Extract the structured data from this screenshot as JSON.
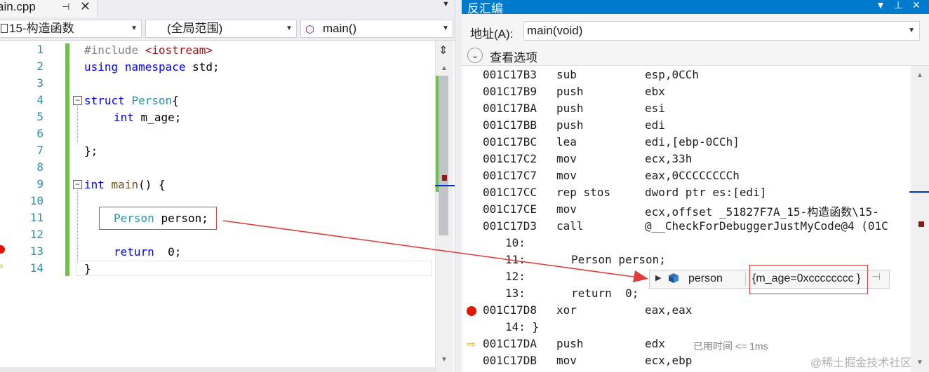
{
  "editor": {
    "tab": {
      "filename": "ain.cpp",
      "pin_icon": "pin-icon",
      "close_icon": "close-icon"
    },
    "nav": {
      "project": "15-构造函数",
      "scope": "(全局范围)",
      "function": "main()"
    },
    "line_numbers": [
      "1",
      "2",
      "3",
      "4",
      "5",
      "6",
      "7",
      "8",
      "9",
      "10",
      "11",
      "12",
      "13",
      "14"
    ],
    "code": {
      "l1_directive": "#include",
      "l1_header": "<iostream>",
      "l2_using": "using",
      "l2_namespace": "namespace",
      "l2_std": "std;",
      "l4_struct": "struct",
      "l4_name": "Person",
      "l4_brace": "{",
      "l5_int": "int",
      "l5_member": "m_age;",
      "l7_close": "};",
      "l9_int": "int",
      "l9_main": "main",
      "l9_rest": "() {",
      "l11_type": "Person",
      "l11_var": "person;",
      "l13_return": "return",
      "l13_val": "0;",
      "l14_close": "}"
    }
  },
  "disassembly": {
    "title": "反汇编",
    "address_label": "地址(A):",
    "address_value": "main(void)",
    "options_label": "查看选项",
    "rows": [
      {
        "addr": "001C17B3",
        "mn": "sub",
        "op": "esp,0CCh"
      },
      {
        "addr": "001C17B9",
        "mn": "push",
        "op": "ebx"
      },
      {
        "addr": "001C17BA",
        "mn": "push",
        "op": "esi"
      },
      {
        "addr": "001C17BB",
        "mn": "push",
        "op": "edi"
      },
      {
        "addr": "001C17BC",
        "mn": "lea",
        "op": "edi,[ebp-0CCh]"
      },
      {
        "addr": "001C17C2",
        "mn": "mov",
        "op": "ecx,33h"
      },
      {
        "addr": "001C17C7",
        "mn": "mov",
        "op": "eax,0CCCCCCCCh"
      },
      {
        "addr": "001C17CC",
        "mn": "rep stos",
        "op": "dword ptr es:[edi]"
      },
      {
        "addr": "001C17CE",
        "mn": "mov",
        "op": "ecx,offset _51827F7A_15-构造函数\\15-"
      },
      {
        "addr": "001C17D3",
        "mn": "call",
        "op": "@__CheckForDebuggerJustMyCode@4 (01C"
      }
    ],
    "source_lines": [
      {
        "num": "10:",
        "text": ""
      },
      {
        "num": "11:",
        "text": "Person person;"
      },
      {
        "num": "12:",
        "text": ""
      },
      {
        "num": "13:",
        "text": "return  0;"
      }
    ],
    "bp_row": {
      "addr": "001C17D8",
      "mn": "xor",
      "op": "eax,eax"
    },
    "source_14": "14: }",
    "current_row": {
      "addr": "001C17DA",
      "mn": "push",
      "op": "edx"
    },
    "last_row": {
      "addr": "001C17DB",
      "mn": "mov",
      "op": "ecx,ebp"
    },
    "elapsed": "已用时间 <= 1ms",
    "watermark": "@稀土掘金技术社区"
  },
  "datatip": {
    "name": "person",
    "value": "{m_age=0xcccccccc }"
  },
  "colors": {
    "accent": "#007acc",
    "breakpoint": "#e51400",
    "annotation": "#e03c3c",
    "change_bar": "#6cc24a"
  }
}
